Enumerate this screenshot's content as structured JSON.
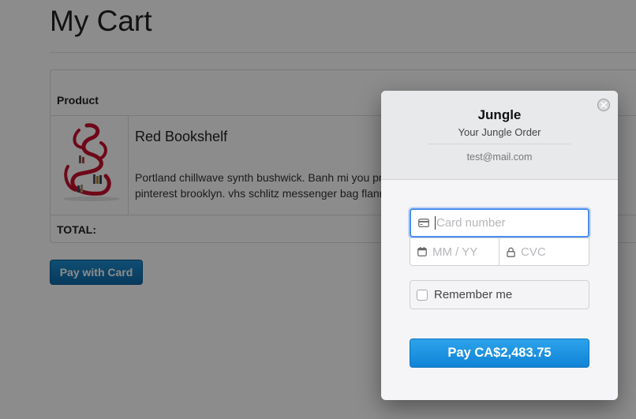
{
  "page": {
    "title": "My Cart",
    "table": {
      "column_header": "Product",
      "product": {
        "name": "Red Bookshelf",
        "description": "Portland chillwave synth bushwick. Banh mi you probably haven't heard of them tumblr, mustache pinterest brooklyn. vhs schlitz messenger bag flannel scenester. Slow-carb"
      },
      "total_label": "TOTAL:"
    },
    "pay_button": "Pay with Card"
  },
  "checkout": {
    "merchant": "Jungle",
    "description": "Your Jungle Order",
    "email": "test@mail.com",
    "card_number_placeholder": "Card number",
    "expiry_placeholder": "MM / YY",
    "cvc_placeholder": "CVC",
    "remember_label": "Remember me",
    "pay_label": "Pay CA$2,483.75"
  },
  "icons": {
    "close": "close-icon",
    "card": "credit-card-icon",
    "calendar": "calendar-icon",
    "lock": "lock-icon"
  },
  "colors": {
    "accent": "#1a8fdd",
    "focus": "#4b8ff0",
    "product": "#c8102e"
  }
}
